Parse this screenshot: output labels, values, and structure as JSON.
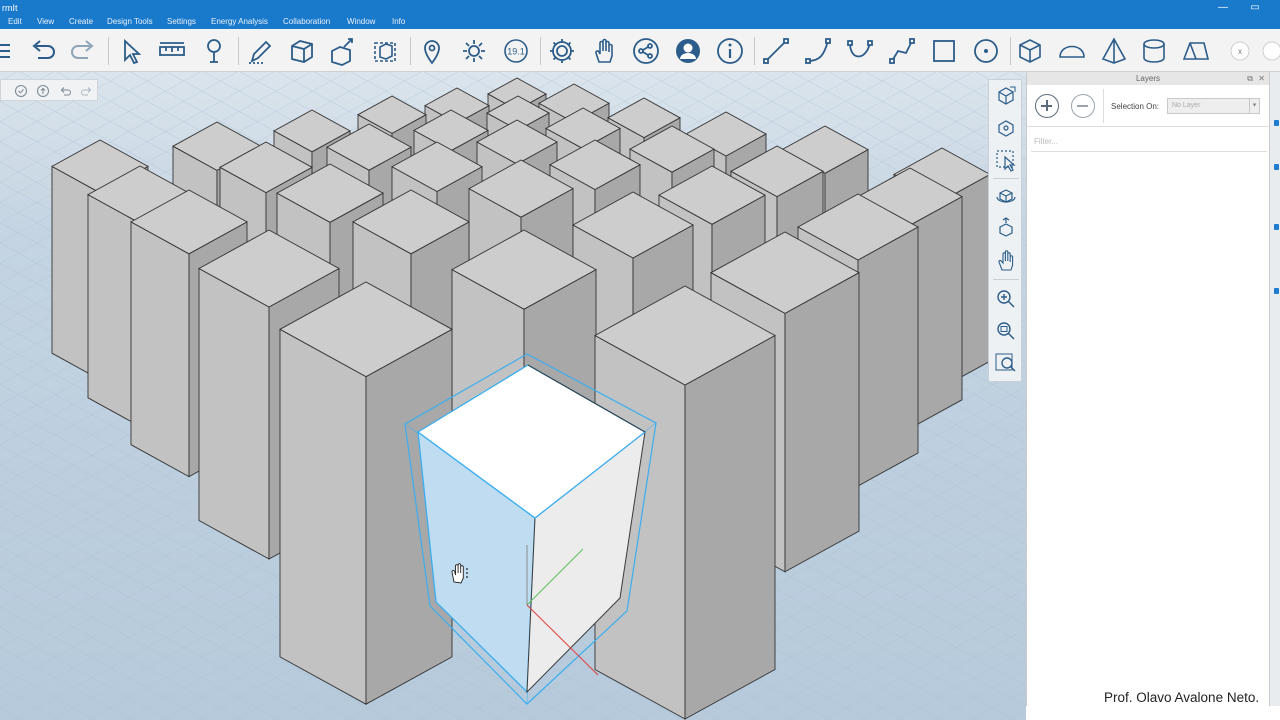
{
  "app": {
    "title": "rmIt"
  },
  "window_controls": {
    "minimize": "—",
    "maximize": "▭"
  },
  "menu": [
    {
      "id": "edit",
      "label": "Edit"
    },
    {
      "id": "view",
      "label": "View"
    },
    {
      "id": "create",
      "label": "Create"
    },
    {
      "id": "design-tools",
      "label": "Design Tools"
    },
    {
      "id": "settings",
      "label": "Settings"
    },
    {
      "id": "energy-analysis",
      "label": "Energy Analysis"
    },
    {
      "id": "collaboration",
      "label": "Collaboration"
    },
    {
      "id": "window",
      "label": "Window"
    },
    {
      "id": "info",
      "label": "Info"
    }
  ],
  "toolbar": {
    "sun_time_badge": "19.1",
    "close_label": "x",
    "tools": [
      "menu-icon",
      "undo-icon",
      "redo-icon",
      "select-icon",
      "measure-icon",
      "paint-icon",
      "sketch-pencil-icon",
      "add-box-icon",
      "push-pull-icon",
      "transform-box-icon",
      "location-pin-icon",
      "sun-icon",
      "sun-time-icon",
      "gear-icon",
      "hand-icon",
      "share-icon",
      "user-icon",
      "info-icon",
      "line-icon",
      "arc-icon",
      "curve-icon",
      "polyline-icon",
      "rectangle-icon",
      "circle-icon",
      "cube-icon",
      "dome-icon",
      "pyramid-icon",
      "cylinder-icon",
      "prism-icon"
    ]
  },
  "layers_panel": {
    "title": "Layers",
    "selection_label": "Selection On:",
    "selection_value": "No Layer",
    "filter_placeholder": "Filter..."
  },
  "credit": "Prof. Olavo Avalone Neto.",
  "colors": {
    "title_bar": "#1979ca",
    "selection_highlight": "#3aaef0",
    "grid_floor": "#b9ccdd",
    "building_top": "#cdcdcd",
    "building_side_light": "#c2c2c2",
    "building_side_dark": "#a8a8a8"
  }
}
